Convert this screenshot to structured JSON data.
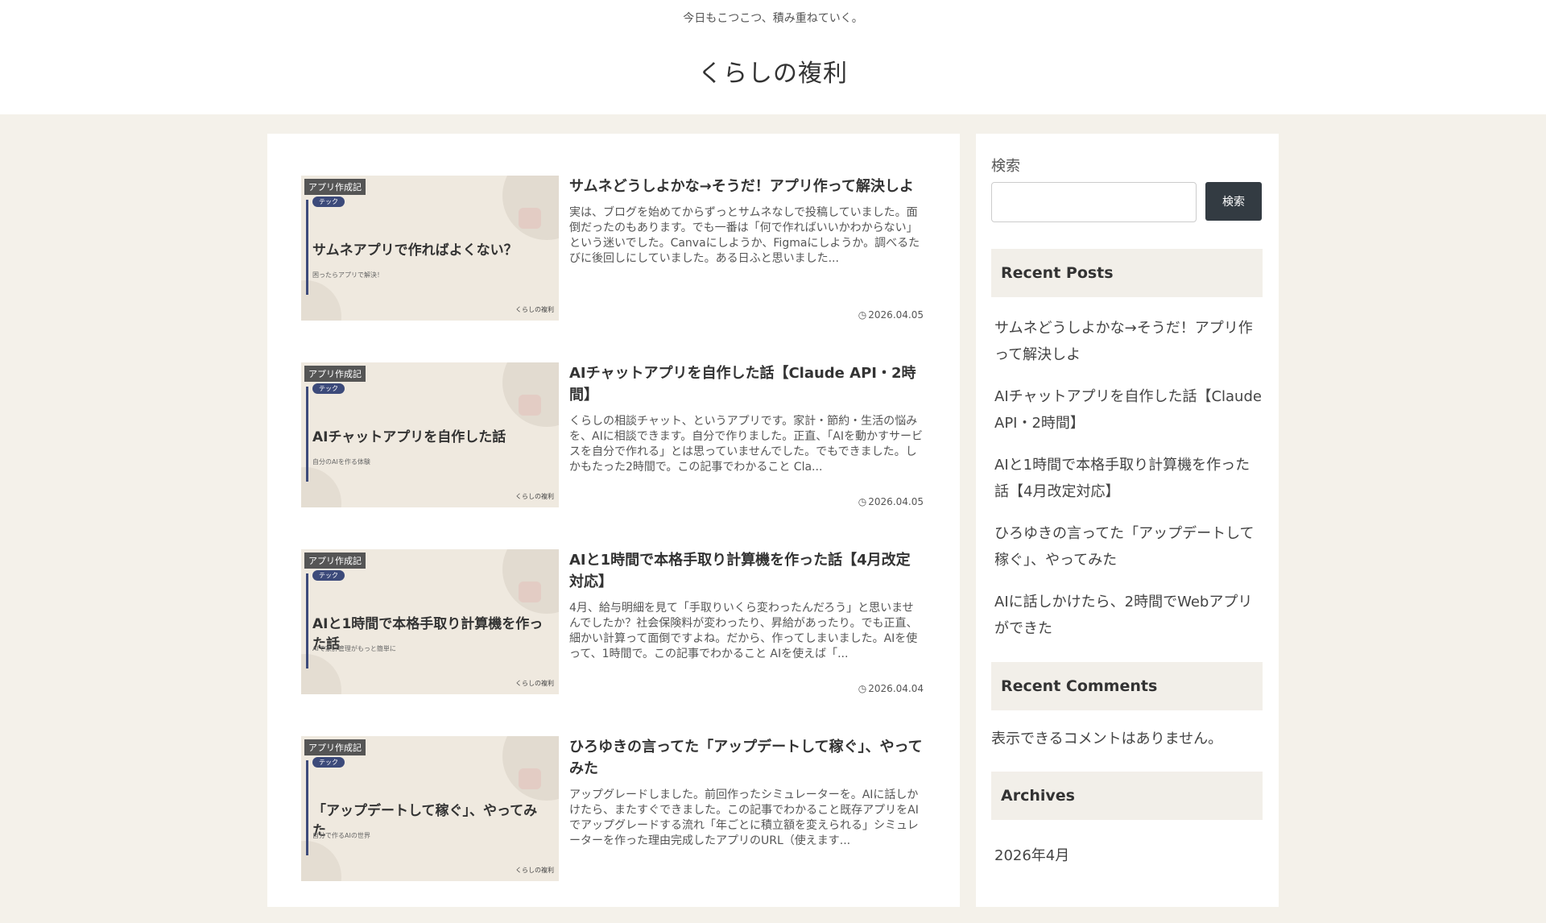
{
  "header": {
    "tagline": "今日もこつこつ、積み重ねていく。",
    "site_title": "くらしの複利"
  },
  "posts": [
    {
      "category": "アプリ作成記",
      "tag": "テック",
      "thumb_title": "サムネアプリで作ればよくない？",
      "thumb_subtitle": "困ったらアプリで解決！",
      "thumb_brand": "くらしの複利",
      "title": "サムネどうしよかな→そうだ！アプリ作って解決しよ",
      "excerpt": "実は、ブログを始めてからずっとサムネなしで投稿していました。面倒だったのもあります。でも一番は「何で作ればいいかわからない」という迷いでした。Canvaにしようか、Figmaにしようか。調べるたびに後回しにしていました。ある日ふと思いました...",
      "date": "2026.04.05"
    },
    {
      "category": "アプリ作成記",
      "tag": "テック",
      "thumb_title": "AIチャットアプリを自作した話",
      "thumb_subtitle": "自分のAIを作る体験",
      "thumb_brand": "くらしの複利",
      "title": "AIチャットアプリを自作した話【Claude API・2時間】",
      "excerpt": "くらしの相談チャット、というアプリです。家計・節約・生活の悩みを、AIに相談できます。自分で作りました。正直、「AIを動かすサービスを自分で作れる」とは思っていませんでした。でもできました。しかもたった2時間で。この記事でわかること Cla...",
      "date": "2026.04.05"
    },
    {
      "category": "アプリ作成記",
      "tag": "テック",
      "thumb_title": "AIと1時間で本格手取り計算機を作った話",
      "thumb_subtitle": "AIで家計管理がもっと簡単に",
      "thumb_brand": "くらしの複利",
      "title": "AIと1時間で本格手取り計算機を作った話【4月改定対応】",
      "excerpt": "4月、給与明細を見て「手取りいくら変わったんだろう」と思いませんでしたか？社会保険料が変わったり、昇給があったり。でも正直、細かい計算って面倒ですよね。だから、作ってしまいました。AIを使って、1時間で。この記事でわかること AIを使えば「...",
      "date": "2026.04.04"
    },
    {
      "category": "アプリ作成記",
      "tag": "テック",
      "thumb_title": "「アップデートして稼ぐ」、やってみた",
      "thumb_subtitle": "自分で作るAIの世界",
      "thumb_brand": "くらしの複利",
      "title": "ひろゆきの言ってた「アップデートして稼ぐ」、やってみた",
      "excerpt": "アップグレードしました。前回作ったシミュレーターを。AIに話しかけたら、またすぐできました。この記事でわかること既存アプリをAIでアップグレードする流れ「年ごとに積立額を変えられる」シミュレーターを作った理由完成したアプリのURL（使えます...",
      "date": ""
    }
  ],
  "sidebar": {
    "search_label": "検索",
    "search_button": "検索",
    "search_placeholder": "",
    "recent_posts_heading": "Recent Posts",
    "recent_posts": [
      "サムネどうしよかな→そうだ！アプリ作って解決しよ",
      "AIチャットアプリを自作した話【Claude API・2時間】",
      "AIと1時間で本格手取り計算機を作った話【4月改定対応】",
      "ひろゆきの言ってた「アップデートして稼ぐ」、やってみた",
      "AIに話しかけたら、2時間でWebアプリができた"
    ],
    "recent_comments_heading": "Recent Comments",
    "no_comments": "表示できるコメントはありません。",
    "archives_heading": "Archives",
    "archives": [
      "2026年4月"
    ]
  },
  "colors": {
    "page_bg": "#f4f1ea",
    "button_bg": "#333b42",
    "tag_pill": "#3c4a7a",
    "widget_head_bg": "#f2efe9"
  }
}
